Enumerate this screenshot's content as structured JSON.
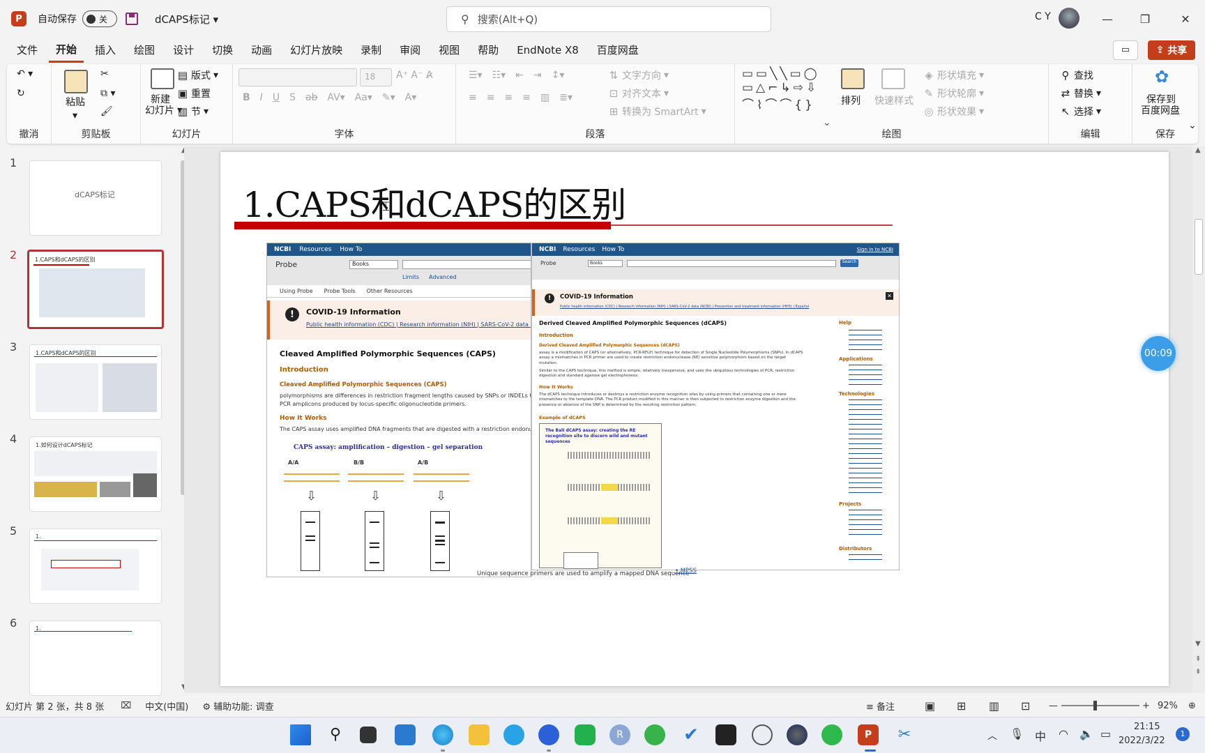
{
  "titlebar": {
    "app_icon": "P",
    "autosave_label": "自动保存",
    "autosave_state": "关",
    "doc_title": "dCAPS标记",
    "search_placeholder": "搜索(Alt+Q)",
    "user_initials": "C Y"
  },
  "menu": {
    "items": [
      "文件",
      "开始",
      "插入",
      "绘图",
      "设计",
      "切换",
      "动画",
      "幻灯片放映",
      "录制",
      "审阅",
      "视图",
      "帮助",
      "EndNote X8",
      "百度网盘"
    ],
    "active": "开始",
    "share_label": "共享"
  },
  "ribbon": {
    "groups": {
      "undo": "撤消",
      "clipboard": "剪贴板",
      "slides": "幻灯片",
      "font": "字体",
      "paragraph": "段落",
      "drawing": "绘图",
      "edit": "编辑",
      "save": "保存"
    },
    "paste": "粘贴",
    "new_slide_1": "新建",
    "new_slide_2": "幻灯片",
    "layout": "版式",
    "reset": "重置",
    "section": "节",
    "font_size": "18",
    "text_direction": "文字方向",
    "align_text": "对齐文本",
    "smartart": "转换为 SmartArt",
    "arrange": "排列",
    "quick_styles": "快速样式",
    "shape_fill": "形状填充",
    "shape_outline": "形状轮廓",
    "shape_effect": "形状效果",
    "find": "查找",
    "replace": "替换",
    "select": "选择",
    "save_to_1": "保存到",
    "save_to_2": "百度网盘"
  },
  "thumbnails": [
    {
      "num": "1",
      "title": "dCAPS标记"
    },
    {
      "num": "2",
      "title": "1.CAPS和dCAPS的区别"
    },
    {
      "num": "3",
      "title": "1.CAPS和dCAPS的区别"
    },
    {
      "num": "4",
      "title": "1.如何设计dCAPS标记"
    },
    {
      "num": "5",
      "title": "1."
    },
    {
      "num": "6",
      "title": "1."
    }
  ],
  "slide": {
    "title": "1.CAPS和dCAPS的区别",
    "left_page": {
      "nav": [
        "NCBI",
        "Resources",
        "How To"
      ],
      "probe": "Probe",
      "db": "Books",
      "limits": "Limits",
      "advanced": "Advanced",
      "tabs": [
        "Using Probe",
        "Probe Tools",
        "Other Resources"
      ],
      "covid_title": "COVID-19 Information",
      "covid_links": "Public health information (CDC)  |  Research information (NIH)  |  SARS-CoV-2 data (NC",
      "heading": "Cleaved Amplified Polymorphic Sequences (CAPS)",
      "intro": "Introduction",
      "subhead": "Cleaved Amplified Polymorphic Sequences (CAPS)",
      "para1": "polymorphisms are differences in restriction fragment lengths caused by SNPs or INDELs that create",
      "para2": "PCR amplicons produced by locus-specific oligonucleotide primers.",
      "how": "How It Works",
      "para3": "The CAPS assay uses amplified DNA fragments that are digested with a restriction endonuclease to",
      "assay_title": "CAPS assay: amplification – digestion – gel separation",
      "genotypes": [
        "A/A",
        "B/B",
        "A/B"
      ]
    },
    "right_page": {
      "sign_in": "Sign in to NCBI",
      "probe": "Probe",
      "db": "Books",
      "search_btn": "Search",
      "covid_title": "COVID-19 Information",
      "covid_links": "Public health information (CDC) | Research information (NIH) | SARS-CoV-2 data (NCBI) | Prevention and treatment information (HHS) | Español",
      "heading": "Derived Cleaved Amplified Polymorphic Sequences (dCAPS)",
      "intro": "Introduction",
      "subhead": "Derived Cleaved Amplified Polymorphic Sequences (dCAPS)",
      "para1": "assay is a modification of CAPS (or alternatively, PCR-RFLP) technique for detection of Single Nucleotide Polymorphisms (SNPs). In dCAPS assay a mismatches in PCR primer are used to create restriction endonuclease (RE) sensitive polymorphism based on the target mutation.",
      "para2": "Similar to the CAPS technique, this method is simple, relatively inexpensive, and uses the ubiquitous technologies of PCR, restriction digestion and standard agarose gel electrophoresis.",
      "how": "How It Works",
      "para3": "The dCAPS technique introduces or destroys a restriction enzyme recognition sites by using primers that containing one or more mismatches to the template DNA. The PCR product modified in this manner is then subjected to restriction enzyme digestion and the presence or absence of the SNP is determined by the resulting restriction pattern.",
      "example": "Example of dCAPS",
      "fig_title": "The BalI dCAPS assay: creating the RE recognition site to discern wild and mutant sequences",
      "caption": "Unique sequence primers are used to amplify a mapped DNA sequence",
      "side_help": "Help",
      "side_apps": "Applications",
      "side_tech": "Technologies",
      "side_projects": "Projects",
      "side_dist": "Distributors",
      "side_mpss": "MPSS"
    }
  },
  "timer": "00:09",
  "status": {
    "slide_info": "幻灯片 第 2 张，共 8 张",
    "language": "中文(中国)",
    "accessibility": "辅助功能: 调查",
    "notes": "备注",
    "zoom": "92%"
  },
  "tray": {
    "ime": "中",
    "time": "21:15",
    "date": "2022/3/22",
    "badge": "1"
  },
  "colors": {
    "accent": "#c43e1c",
    "slide_red": "#c40000",
    "ncbi_blue": "#20558a",
    "timer_blue": "#3c9ee8"
  }
}
